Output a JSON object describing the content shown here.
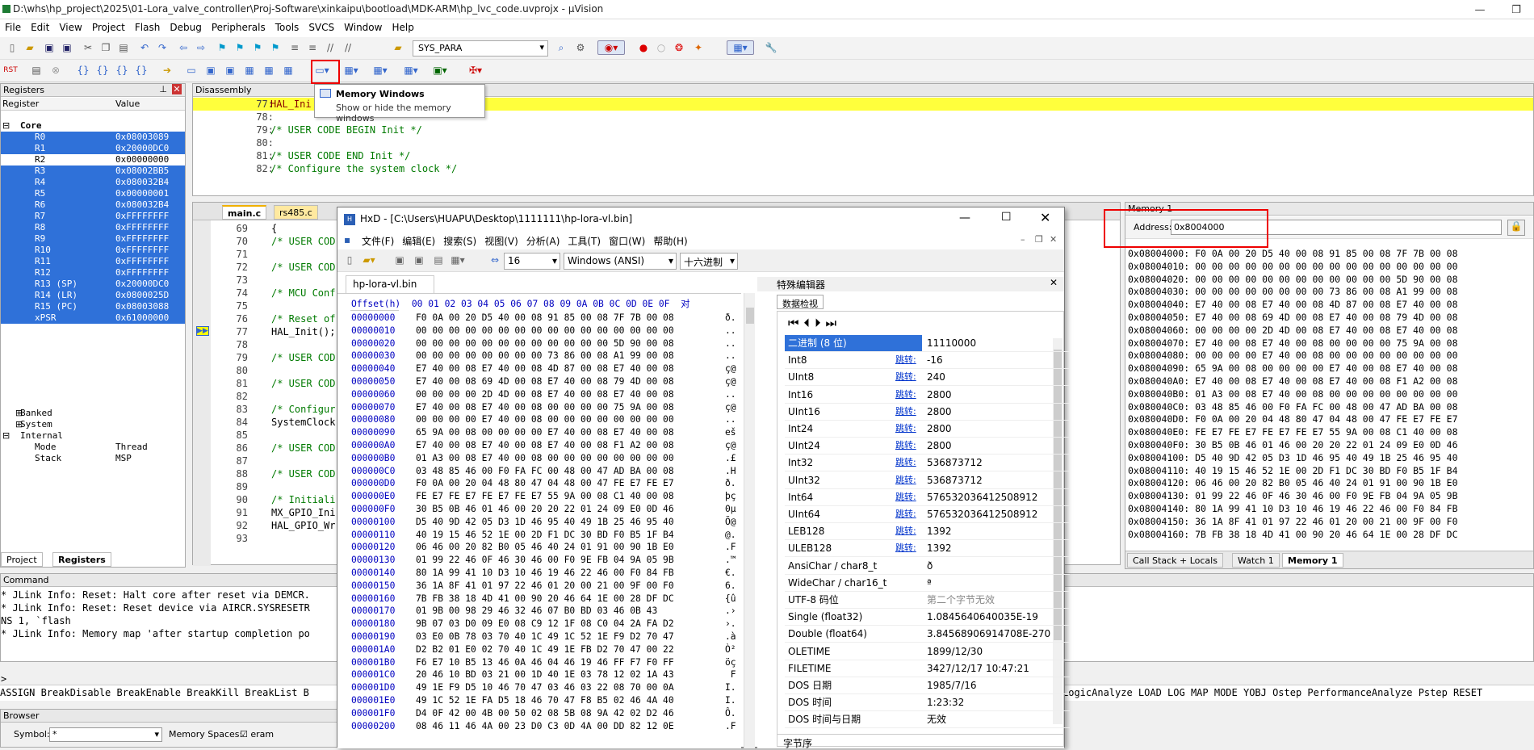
{
  "window": {
    "title": "D:\\whs\\hp_project\\2025\\01-Lora_valve_controller\\Proj-Software\\xinkaipu\\bootload\\MDK-ARM\\hp_lvc_code.uvprojx - µVision",
    "menus": [
      "File",
      "Edit",
      "View",
      "Project",
      "Flash",
      "Debug",
      "Peripherals",
      "Tools",
      "SVCS",
      "Window",
      "Help"
    ],
    "target": "SYS_PARA"
  },
  "tooltip": {
    "title": "Memory Windows",
    "desc": "Show or hide the memory windows"
  },
  "registers": {
    "title": "Registers",
    "col_register": "Register",
    "col_value": "Value",
    "core_label": "Core",
    "rows": [
      {
        "name": "R0",
        "value": "0x08003089",
        "sel": true
      },
      {
        "name": "R1",
        "value": "0x20000DC0",
        "sel": true
      },
      {
        "name": "R2",
        "value": "0x00000000",
        "sel": false
      },
      {
        "name": "R3",
        "value": "0x08002BB5",
        "sel": true
      },
      {
        "name": "R4",
        "value": "0x080032B4",
        "sel": true
      },
      {
        "name": "R5",
        "value": "0x00000001",
        "sel": true
      },
      {
        "name": "R6",
        "value": "0x080032B4",
        "sel": true
      },
      {
        "name": "R7",
        "value": "0xFFFFFFFF",
        "sel": true
      },
      {
        "name": "R8",
        "value": "0xFFFFFFFF",
        "sel": true
      },
      {
        "name": "R9",
        "value": "0xFFFFFFFF",
        "sel": true
      },
      {
        "name": "R10",
        "value": "0xFFFFFFFF",
        "sel": true
      },
      {
        "name": "R11",
        "value": "0xFFFFFFFF",
        "sel": true
      },
      {
        "name": "R12",
        "value": "0xFFFFFFFF",
        "sel": true
      },
      {
        "name": "R13 (SP)",
        "value": "0x20000DC0",
        "sel": true
      },
      {
        "name": "R14 (LR)",
        "value": "0x0800025D",
        "sel": true
      },
      {
        "name": "R15 (PC)",
        "value": "0x08003088",
        "sel": true
      },
      {
        "name": "xPSR",
        "value": "0x61000000",
        "sel": true
      }
    ],
    "groups": [
      "Banked",
      "System",
      "Internal"
    ],
    "internal": [
      {
        "name": "Mode",
        "value": "Thread"
      },
      {
        "name": "Stack",
        "value": "MSP"
      }
    ],
    "tabs": [
      "Project",
      "Registers"
    ]
  },
  "disassembly": {
    "title": "Disassembly",
    "lines": [
      {
        "n": "77:",
        "t": "HAL_Ini",
        "hl": true
      },
      {
        "n": "78:",
        "t": "",
        "hl": false
      },
      {
        "n": "79:",
        "t": "/* USER CODE BEGIN Init */",
        "hl": false
      },
      {
        "n": "80:",
        "t": "",
        "hl": false
      },
      {
        "n": "81:",
        "t": "/* USER CODE END Init */",
        "hl": false
      },
      {
        "n": "82:",
        "t": "/* Configure the system clock */",
        "hl": false
      }
    ]
  },
  "editor": {
    "tabs": [
      "main.c",
      "rs485.c"
    ],
    "lines": [
      {
        "n": "69",
        "c": "{"
      },
      {
        "n": "70",
        "c": "/* USER COD"
      },
      {
        "n": "71",
        "c": ""
      },
      {
        "n": "72",
        "c": "/* USER COD"
      },
      {
        "n": "73",
        "c": ""
      },
      {
        "n": "74",
        "c": "/* MCU Conf"
      },
      {
        "n": "75",
        "c": ""
      },
      {
        "n": "76",
        "c": "/* Reset of"
      },
      {
        "n": "77",
        "c": "HAL_Init();"
      },
      {
        "n": "78",
        "c": ""
      },
      {
        "n": "79",
        "c": "/* USER COD"
      },
      {
        "n": "80",
        "c": ""
      },
      {
        "n": "81",
        "c": "/* USER COD"
      },
      {
        "n": "82",
        "c": ""
      },
      {
        "n": "83",
        "c": "/* Configur"
      },
      {
        "n": "84",
        "c": "SystemClock"
      },
      {
        "n": "85",
        "c": ""
      },
      {
        "n": "86",
        "c": "/* USER COD"
      },
      {
        "n": "87",
        "c": ""
      },
      {
        "n": "88",
        "c": "/* USER COD"
      },
      {
        "n": "89",
        "c": ""
      },
      {
        "n": "90",
        "c": "/* Initiali"
      },
      {
        "n": "91",
        "c": "MX_GPIO_Ini"
      },
      {
        "n": "92",
        "c": "HAL_GPIO_Wr"
      },
      {
        "n": "93",
        "c": ""
      }
    ]
  },
  "memory": {
    "title": "Memory 1",
    "address_label": "Address:",
    "address_value": "0x8004000",
    "lines": [
      "0x08004000: F0 0A 00 20 D5 40 00 08 91 85 00 08 7F 7B 00 08",
      "0x08004010: 00 00 00 00 00 00 00 00 00 00 00 00 00 00 00 00",
      "0x08004020: 00 00 00 00 00 00 00 00 00 00 00 00 5D 90 00 08",
      "0x08004030: 00 00 00 00 00 00 00 00 73 86 00 08 A1 99 00 08",
      "0x08004040: E7 40 00 08 E7 40 00 08 4D 87 00 08 E7 40 00 08",
      "0x08004050: E7 40 00 08 69 4D 00 08 E7 40 00 08 79 4D 00 08",
      "0x08004060: 00 00 00 00 2D 4D 00 08 E7 40 00 08 E7 40 00 08",
      "0x08004070: E7 40 00 08 E7 40 00 08 00 00 00 00 75 9A 00 08",
      "0x08004080: 00 00 00 00 E7 40 00 08 00 00 00 00 00 00 00 00",
      "0x08004090: 65 9A 00 08 00 00 00 00 E7 40 00 08 E7 40 00 08",
      "0x080040A0: E7 40 00 08 E7 40 00 08 E7 40 00 08 F1 A2 00 08",
      "0x080040B0: 01 A3 00 08 E7 40 00 08 00 00 00 00 00 00 00 00",
      "0x080040C0: 03 48 85 46 00 F0 FA FC 00 48 00 47 AD BA 00 08",
      "0x080040D0: F0 0A 00 20 04 48 80 47 04 48 00 47 FE E7 FE E7",
      "0x080040E0: FE E7 FE E7 FE E7 FE E7 55 9A 00 08 C1 40 00 08",
      "0x080040F0: 30 B5 0B 46 01 46 00 20 20 22 01 24 09 E0 0D 46",
      "0x08004100: D5 40 9D 42 05 D3 1D 46 95 40 49 1B 25 46 95 40",
      "0x08004110: 40 19 15 46 52 1E 00 2D F1 DC 30 BD F0 B5 1F B4",
      "0x08004120: 06 46 00 20 82 B0 05 46 40 24 01 91 00 90 1B E0",
      "0x08004130: 01 99 22 46 0F 46 30 46 00 F0 9E FB 04 9A 05 9B",
      "0x08004140: 80 1A 99 41 10 D3 10 46 19 46 22 46 00 F0 84 FB",
      "0x08004150: 36 1A 8F 41 01 97 22 46 01 20 00 21 00 9F 00 F0",
      "0x08004160: 7B FB 38 18 4D 41 00 90 20 46 64 1E 00 28 DF DC"
    ],
    "tabs": [
      "Call Stack + Locals",
      "Watch 1",
      "Memory 1"
    ]
  },
  "command": {
    "title": "Command",
    "lines": [
      "* JLink Info: Reset: Halt core after reset via DEMCR.",
      "* JLink Info: Reset: Reset device via AIRCR.SYSRESETR",
      "NS 1, `flash",
      "* JLink Info: Memory map 'after startup completion po"
    ],
    "prompt": ">",
    "assign_left": "ASSIGN BreakDisable BreakEnable BreakKill BreakList B",
    "assign_right": "LogicAnalyze LOAD LOG MAP MODE YOBJ Ostep PerformanceAnalyze Pstep RESET"
  },
  "browser": {
    "title": "Browser",
    "symbol_label": "Symbol:",
    "symbol_value": "*",
    "mem_spaces_label": "Memory Spaces:",
    "eram": "eram"
  },
  "hxd": {
    "title": "HxD - [C:\\Users\\HUAPU\\Desktop\\1111111\\hp-lora-vl.bin]",
    "menus": [
      "文件(F)",
      "编辑(E)",
      "搜索(S)",
      "视图(V)",
      "分析(A)",
      "工具(T)",
      "窗口(W)",
      "帮助(H)"
    ],
    "bytes_per_row": "16",
    "charset": "Windows (ANSI)",
    "base": "十六进制",
    "file_tab": "hp-lora-vl.bin",
    "offset_header": "Offset(h)  00 01 02 03 04 05 06 07 08 09 0A 0B 0C 0D 0E 0F  对",
    "rows": [
      {
        "off": "00000000",
        "hex": "F0 0A 00 20 D5 40 00 08 91 85 00 08 7F 7B 00 08",
        "asc": "ð."
      },
      {
        "off": "00000010",
        "hex": "00 00 00 00 00 00 00 00 00 00 00 00 00 00 00 00",
        "asc": ".."
      },
      {
        "off": "00000020",
        "hex": "00 00 00 00 00 00 00 00 00 00 00 00 5D 90 00 08",
        "asc": ".."
      },
      {
        "off": "00000030",
        "hex": "00 00 00 00 00 00 00 00 73 86 00 08 A1 99 00 08",
        "asc": ".."
      },
      {
        "off": "00000040",
        "hex": "E7 40 00 08 E7 40 00 08 4D 87 00 08 E7 40 00 08",
        "asc": "ç@"
      },
      {
        "off": "00000050",
        "hex": "E7 40 00 08 69 4D 00 08 E7 40 00 08 79 4D 00 08",
        "asc": "ç@"
      },
      {
        "off": "00000060",
        "hex": "00 00 00 00 2D 4D 00 08 E7 40 00 08 E7 40 00 08",
        "asc": ".."
      },
      {
        "off": "00000070",
        "hex": "E7 40 00 08 E7 40 00 08 00 00 00 00 75 9A 00 08",
        "asc": "ç@"
      },
      {
        "off": "00000080",
        "hex": "00 00 00 00 E7 40 00 08 00 00 00 00 00 00 00 00",
        "asc": ".."
      },
      {
        "off": "00000090",
        "hex": "65 9A 00 08 00 00 00 00 E7 40 00 08 E7 40 00 08",
        "asc": "eš"
      },
      {
        "off": "000000A0",
        "hex": "E7 40 00 08 E7 40 00 08 E7 40 00 08 F1 A2 00 08",
        "asc": "ç@"
      },
      {
        "off": "000000B0",
        "hex": "01 A3 00 08 E7 40 00 08 00 00 00 00 00 00 00 00",
        "asc": ".£"
      },
      {
        "off": "000000C0",
        "hex": "03 48 85 46 00 F0 FA FC 00 48 00 47 AD BA 00 08",
        "asc": ".H"
      },
      {
        "off": "000000D0",
        "hex": "F0 0A 00 20 04 48 80 47 04 48 00 47 FE E7 FE E7",
        "asc": "ð."
      },
      {
        "off": "000000E0",
        "hex": "FE E7 FE E7 FE E7 FE E7 55 9A 00 08 C1 40 00 08",
        "asc": "þç"
      },
      {
        "off": "000000F0",
        "hex": "30 B5 0B 46 01 46 00 20 20 22 01 24 09 E0 0D 46",
        "asc": "0µ"
      },
      {
        "off": "00000100",
        "hex": "D5 40 9D 42 05 D3 1D 46 95 40 49 1B 25 46 95 40",
        "asc": "Õ@"
      },
      {
        "off": "00000110",
        "hex": "40 19 15 46 52 1E 00 2D F1 DC 30 BD F0 B5 1F B4",
        "asc": "@."
      },
      {
        "off": "00000120",
        "hex": "06 46 00 20 82 B0 05 46 40 24 01 91 00 90 1B E0",
        "asc": ".F"
      },
      {
        "off": "00000130",
        "hex": "01 99 22 46 0F 46 30 46 00 F0 9E FB 04 9A 05 9B",
        "asc": ".™"
      },
      {
        "off": "00000140",
        "hex": "80 1A 99 41 10 D3 10 46 19 46 22 46 00 F0 84 FB",
        "asc": "€."
      },
      {
        "off": "00000150",
        "hex": "36 1A 8F 41 01 97 22 46 01 20 00 21 00 9F 00 F0",
        "asc": "6."
      },
      {
        "off": "00000160",
        "hex": "7B FB 38 18 4D 41 00 90 20 46 64 1E 00 28 DF DC",
        "asc": "{û"
      },
      {
        "off": "00000170",
        "hex": "01 9B 00 98 29 46 32 46 07 B0 BD 03 46 0B 43",
        "asc": ".›"
      },
      {
        "off": "00000180",
        "hex": "9B 07 03 D0 09 E0 08 C9 12 1F 08 C0 04 2A FA D2",
        "asc": "›."
      },
      {
        "off": "00000190",
        "hex": "03 E0 0B 78 03 70 40 1C 49 1C 52 1E F9 D2 70 47",
        "asc": ".à"
      },
      {
        "off": "000001A0",
        "hex": "D2 B2 01 E0 02 70 40 1C 49 1E FB D2 70 47 00 22",
        "asc": "Ò²"
      },
      {
        "off": "000001B0",
        "hex": "F6 E7 10 B5 13 46 0A 46 04 46 19 46 FF F7 F0 FF",
        "asc": "öç"
      },
      {
        "off": "000001C0",
        "hex": "20 46 10 BD 03 21 00 1D 40 1E 03 78 12 02 1A 43",
        "asc": " F"
      },
      {
        "off": "000001D0",
        "hex": "49 1E F9 D5 10 46 70 47 03 46 03 22 08 70 00 0A",
        "asc": "I."
      },
      {
        "off": "000001E0",
        "hex": "49 1C 52 1E FA D5 18 46 70 47 F8 B5 02 46 4A 40",
        "asc": "I."
      },
      {
        "off": "000001F0",
        "hex": "D4 0F 42 00 4B 00 50 02 08 5B 08 9A 42 02 D2 46",
        "asc": "Ô."
      },
      {
        "off": "00000200",
        "hex": "08 46 11 46 4A 00 23 D0 C3 0D 4A 00 DD 82 12 0E",
        "asc": ".F"
      }
    ],
    "inspector": {
      "title": "特殊编辑器",
      "tab": "数据检视",
      "jump": "跳转:",
      "rows": [
        {
          "nm": "二进制 (8 位)",
          "vl": "11110000",
          "jump": false,
          "sel": true
        },
        {
          "nm": "Int8",
          "vl": "-16",
          "jump": true
        },
        {
          "nm": "UInt8",
          "vl": "240",
          "jump": true
        },
        {
          "nm": "Int16",
          "vl": "2800",
          "jump": true
        },
        {
          "nm": "UInt16",
          "vl": "2800",
          "jump": true
        },
        {
          "nm": "Int24",
          "vl": "2800",
          "jump": true
        },
        {
          "nm": "UInt24",
          "vl": "2800",
          "jump": true
        },
        {
          "nm": "Int32",
          "vl": "536873712",
          "jump": true
        },
        {
          "nm": "UInt32",
          "vl": "536873712",
          "jump": true
        },
        {
          "nm": "Int64",
          "vl": "576532036412508912",
          "jump": true
        },
        {
          "nm": "UInt64",
          "vl": "576532036412508912",
          "jump": true
        },
        {
          "nm": "LEB128",
          "vl": "1392",
          "jump": true
        },
        {
          "nm": "ULEB128",
          "vl": "1392",
          "jump": true
        },
        {
          "nm": "AnsiChar / char8_t",
          "vl": "ð",
          "jump": false
        },
        {
          "nm": "WideChar / char16_t",
          "vl": "ª",
          "jump": false
        },
        {
          "nm": "UTF-8 码位",
          "vl": "第二个字节无效",
          "jump": false
        },
        {
          "nm": "Single (float32)",
          "vl": "1.0845640640035E-19",
          "jump": false
        },
        {
          "nm": "Double (float64)",
          "vl": "3.84568906914708E-270",
          "jump": false
        },
        {
          "nm": "OLETIME",
          "vl": "1899/12/30",
          "jump": false
        },
        {
          "nm": "FILETIME",
          "vl": "3427/12/17 10:47:21",
          "jump": false
        },
        {
          "nm": "DOS 日期",
          "vl": "1985/7/16",
          "jump": false
        },
        {
          "nm": "DOS 时间",
          "vl": "1:23:32",
          "jump": false
        },
        {
          "nm": "DOS 时间与日期",
          "vl": "无效",
          "jump": false
        }
      ],
      "byte_order": "字节序"
    }
  }
}
